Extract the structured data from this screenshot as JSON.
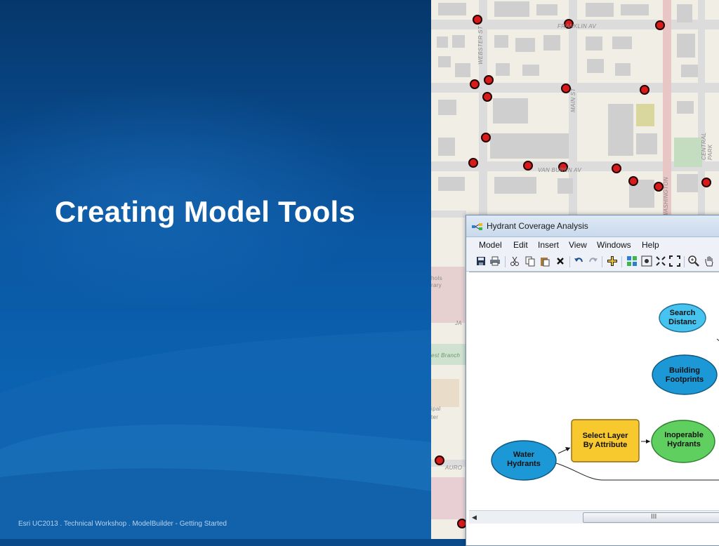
{
  "slide": {
    "title": "Creating Model Tools",
    "footer": "Esri UC2013 . Technical Workshop . ModelBuilder - Getting Started"
  },
  "map": {
    "street_labels": [
      "FRANKLIN AV",
      "WEBSTER ST",
      "MAIN ST",
      "VAN BUREN AV",
      "CENTRAL PARK",
      "WASHINGTON",
      "hols",
      "rary",
      "JA",
      "est Branch",
      "ipal",
      "ter",
      "AURO"
    ]
  },
  "window": {
    "title": "Hydrant Coverage Analysis",
    "menu": [
      "Model",
      "Edit",
      "Insert",
      "View",
      "Windows",
      "Help"
    ],
    "toolbar_icons": [
      "save-icon",
      "print-icon",
      "cut-icon",
      "copy-icon",
      "paste-icon",
      "delete-icon",
      "undo-icon",
      "redo-icon",
      "add-data-icon",
      "auto-layout-icon",
      "full-extent-icon",
      "zoom-in-fixed-icon",
      "zoom-out-fixed-icon",
      "zoom-in-icon",
      "pan-icon"
    ],
    "nodes": {
      "search_distance": "Search Distanc",
      "building_footprints": "Building Footprints",
      "inoperable_hydrants": "Inoperable Hydrants",
      "select_layer": "Select Layer By Attribute",
      "water_hydrants": "Water Hydrants"
    },
    "scroll_grip": "III"
  },
  "colors": {
    "slide_blue": "#0b5aa6",
    "node_blue": "#1a9bd7",
    "node_cyan": "#3fc3ee",
    "node_green": "#5fd05f",
    "node_yellow": "#f8c92e",
    "hydrant_red": "#e01818"
  }
}
